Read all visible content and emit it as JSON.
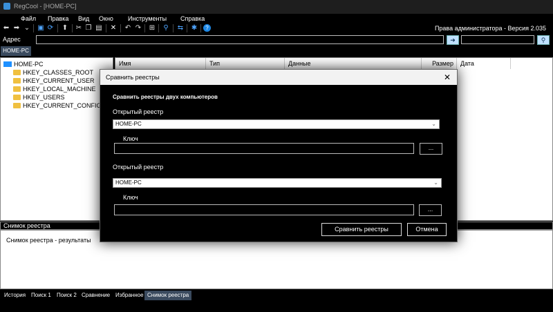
{
  "window": {
    "title": "RegCool - [HOME-PC]"
  },
  "menu": [
    "Файл",
    "Правка",
    "Вид",
    "Окно",
    "Инструменты",
    "Справка"
  ],
  "toolbar": {
    "admin_text": "Права администратора - Версия 2.035",
    "icons": [
      "back-arrow",
      "forward-arrow",
      "dropdown",
      "save",
      "refresh",
      "up-arrow",
      "cut",
      "copy",
      "paste",
      "delete",
      "undo",
      "redo",
      "new-key",
      "find",
      "compare",
      "settings",
      "help"
    ]
  },
  "address": {
    "label": "Адрес",
    "value": "",
    "search_value": ""
  },
  "host_tab": "HOME-PC",
  "tree": {
    "root": "HOME-PC",
    "items": [
      "HKEY_CLASSES_ROOT",
      "HKEY_CURRENT_USER",
      "HKEY_LOCAL_MACHINE",
      "HKEY_USERS",
      "HKEY_CURRENT_CONFIG"
    ]
  },
  "list": {
    "columns": [
      "Имя",
      "Тип",
      "Данные",
      "Размер",
      "Дата"
    ]
  },
  "snapshot": {
    "header": "Снимок реестра",
    "result": "Снимок реестра - результаты"
  },
  "bottom_tabs": [
    {
      "label": "История",
      "active": false
    },
    {
      "label": "Поиск 1",
      "active": false
    },
    {
      "label": "Поиск 2",
      "active": false
    },
    {
      "label": "Сравнение",
      "active": false
    },
    {
      "label": "Избранное",
      "active": false
    },
    {
      "label": "Снимок реестра",
      "active": true
    }
  ],
  "dialog": {
    "title": "Сравнить реестры",
    "heading": "Сравнить реестры двух компьютеров",
    "registry1": {
      "label": "Открытый реестр",
      "value": "HOME-PC",
      "key_label": "Ключ",
      "key_value": "",
      "browse": "..."
    },
    "registry2": {
      "label": "Открытый реестр",
      "value": "HOME-PC",
      "key_label": "Ключ",
      "key_value": "",
      "browse": "..."
    },
    "compare_button": "Сравнить реестры",
    "cancel_button": "Отмена"
  },
  "colors": {
    "accent": "#3a4a5e",
    "title_bg": "#1e1e1e"
  }
}
